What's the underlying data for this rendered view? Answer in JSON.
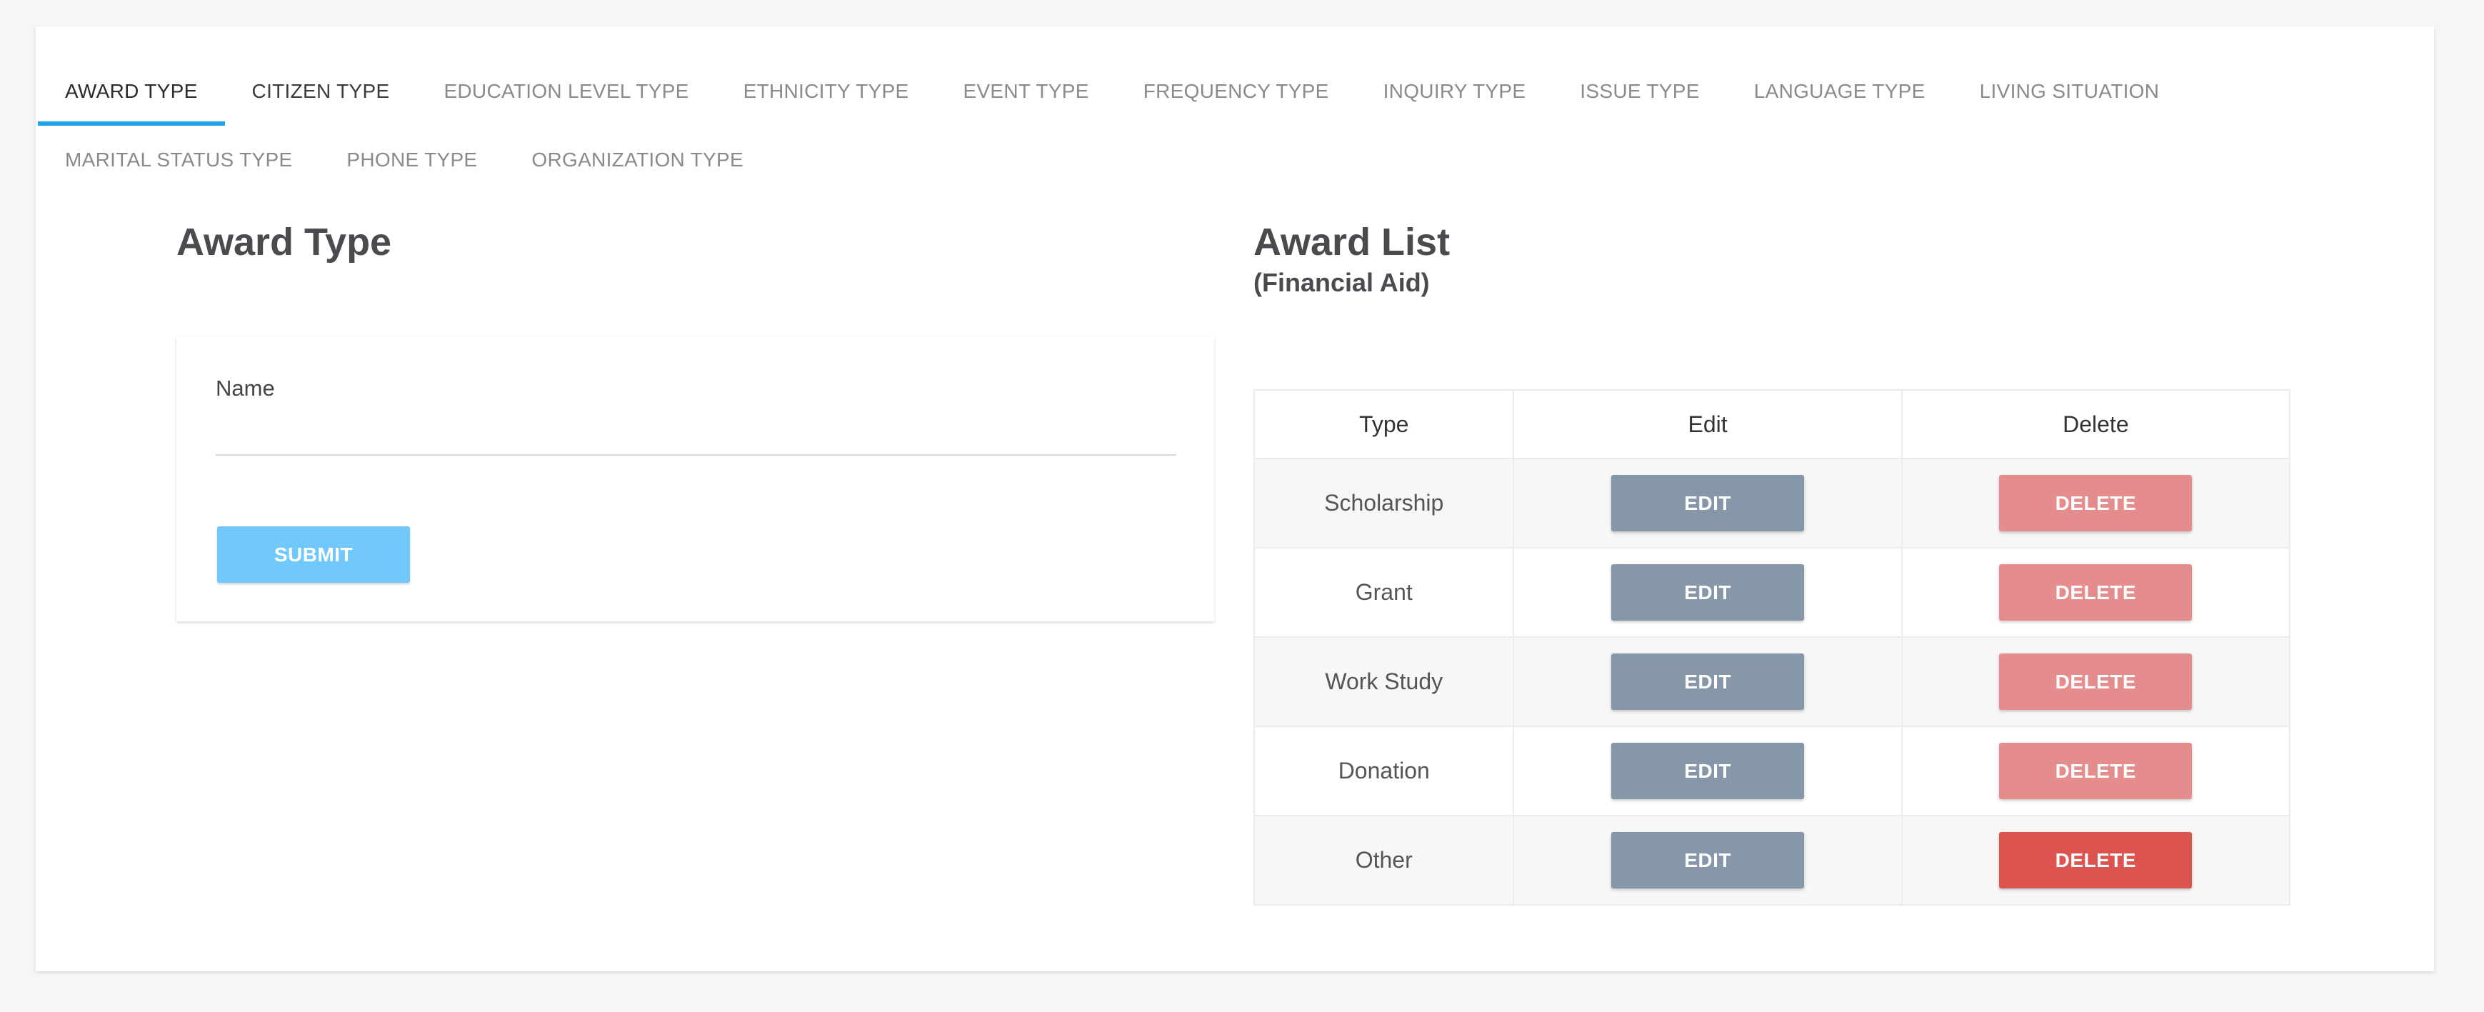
{
  "tabs": {
    "row1": [
      "AWARD TYPE",
      "CITIZEN TYPE",
      "EDUCATION LEVEL TYPE",
      "ETHNICITY TYPE",
      "EVENT TYPE",
      "FREQUENCY TYPE",
      "INQUIRY TYPE",
      "ISSUE TYPE",
      "LANGUAGE TYPE",
      "LIVING SITUATION"
    ],
    "row2": [
      "MARITAL STATUS TYPE",
      "PHONE TYPE",
      "ORGANIZATION TYPE"
    ],
    "active": "AWARD TYPE"
  },
  "form": {
    "title": "Award Type",
    "name_label": "Name",
    "name_value": "",
    "submit_label": "SUBMIT"
  },
  "list": {
    "title": "Award List",
    "subtitle": "(Financial Aid)",
    "columns": [
      "Type",
      "Edit",
      "Delete"
    ],
    "rows": [
      {
        "type": "Scholarship",
        "edit_label": "EDIT",
        "delete_label": "DELETE"
      },
      {
        "type": "Grant",
        "edit_label": "EDIT",
        "delete_label": "DELETE"
      },
      {
        "type": "Work Study",
        "edit_label": "EDIT",
        "delete_label": "DELETE"
      },
      {
        "type": "Donation",
        "edit_label": "EDIT",
        "delete_label": "DELETE"
      },
      {
        "type": "Other",
        "edit_label": "EDIT",
        "delete_label": "DELETE"
      }
    ]
  },
  "colors": {
    "accent": "#1aa3e8",
    "submit": "#70c8fc",
    "edit": "#8797aa",
    "delete": "#e58c8c",
    "delete_hover": "#db5450"
  }
}
